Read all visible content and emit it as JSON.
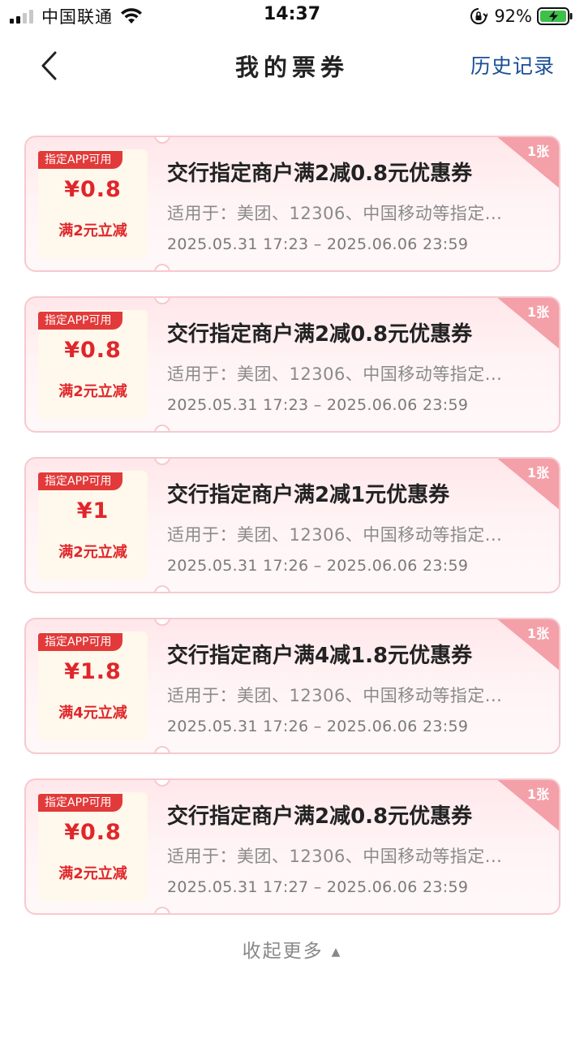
{
  "status_bar": {
    "carrier": "中国联通",
    "time": "14:37",
    "battery_percent": "92%",
    "signal_icon": "signal-bars-icon",
    "wifi_icon": "wifi-icon",
    "rotation_lock_icon": "rotation-lock-icon",
    "battery_icon": "battery-charging-icon"
  },
  "nav": {
    "back_icon": "chevron-left-icon",
    "title": "我的票券",
    "history_label": "历史记录",
    "history_color": "#1a4f96"
  },
  "coupons": [
    {
      "tag": "指定APP可用",
      "amount": "¥0.8",
      "rule": "满2元立减",
      "title": "交行指定商户满2减0.8元优惠券",
      "scope": "适用于：美团、12306、中国移动等指定...",
      "dates": "2025.05.31 17:23 – 2025.06.06 23:59",
      "count": "1张"
    },
    {
      "tag": "指定APP可用",
      "amount": "¥0.8",
      "rule": "满2元立减",
      "title": "交行指定商户满2减0.8元优惠券",
      "scope": "适用于：美团、12306、中国移动等指定...",
      "dates": "2025.05.31 17:23 – 2025.06.06 23:59",
      "count": "1张"
    },
    {
      "tag": "指定APP可用",
      "amount": "¥1",
      "rule": "满2元立减",
      "title": "交行指定商户满2减1元优惠券",
      "scope": "适用于：美团、12306、中国移动等指定...",
      "dates": "2025.05.31 17:26 – 2025.06.06 23:59",
      "count": "1张"
    },
    {
      "tag": "指定APP可用",
      "amount": "¥1.8",
      "rule": "满4元立减",
      "title": "交行指定商户满4减1.8元优惠券",
      "scope": "适用于：美团、12306、中国移动等指定...",
      "dates": "2025.05.31 17:26 – 2025.06.06 23:59",
      "count": "1张"
    },
    {
      "tag": "指定APP可用",
      "amount": "¥0.8",
      "rule": "满2元立减",
      "title": "交行指定商户满2减0.8元优惠券",
      "scope": "适用于：美团、12306、中国移动等指定...",
      "dates": "2025.05.31 17:27 – 2025.06.06 23:59",
      "count": "1张"
    }
  ],
  "footer": {
    "collapse_label": "收起更多",
    "collapse_icon": "triangle-up-icon"
  },
  "colors": {
    "accent_red": "#e0262b",
    "tag_red": "#e23a3a",
    "card_border": "#f7c9cf",
    "corner_badge": "#f4a0a8"
  }
}
